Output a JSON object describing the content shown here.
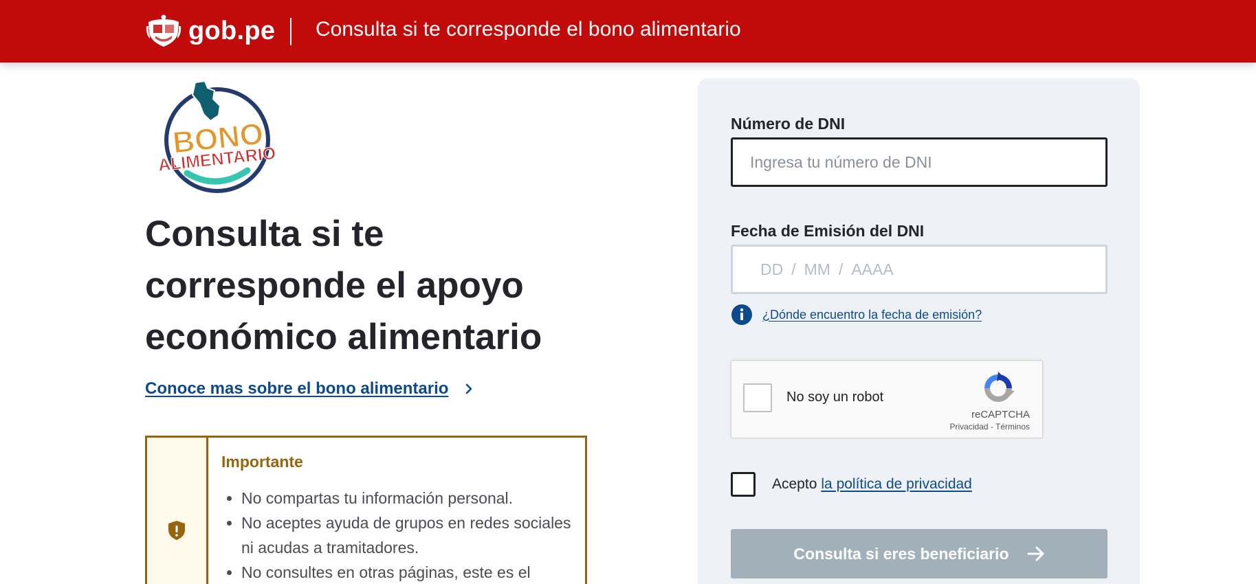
{
  "header": {
    "brand": "gob.pe",
    "title": "Consulta si te corresponde el bono alimentario",
    "background_color": "#c10a0a"
  },
  "logo": {
    "line1": "BONO",
    "line2": "ALIMENTARIO"
  },
  "main": {
    "headline": "Consulta si te corresponde el apoyo económico alimentario",
    "more_link": "Conoce mas sobre el bono alimentario"
  },
  "alert": {
    "title": "Importante",
    "items": [
      "No compartas tu información personal.",
      "No aceptes ayuda de grupos en redes sociales ni acudas a tramitadores.",
      "No consultes en otras páginas, este es el"
    ],
    "accent_color": "#98650f"
  },
  "form": {
    "dni_label": "Número de DNI",
    "dni_placeholder": "Ingresa tu número de DNI",
    "date_label": "Fecha de Emisión del DNI",
    "date_day": "DD",
    "date_month": "MM",
    "date_year": "AAAA",
    "date_separator": "/",
    "help_link": "¿Dónde encuentro la fecha de emisión?",
    "captcha": {
      "label": "No soy un robot",
      "brand": "reCAPTCHA",
      "terms": "Privacidad - Términos"
    },
    "accept_text": "Acepto",
    "accept_link": "la política de privacidad",
    "submit_label": "Consulta si eres beneficiario",
    "link_color": "#0d4a8c",
    "submit_color": "#a2b1b9"
  }
}
